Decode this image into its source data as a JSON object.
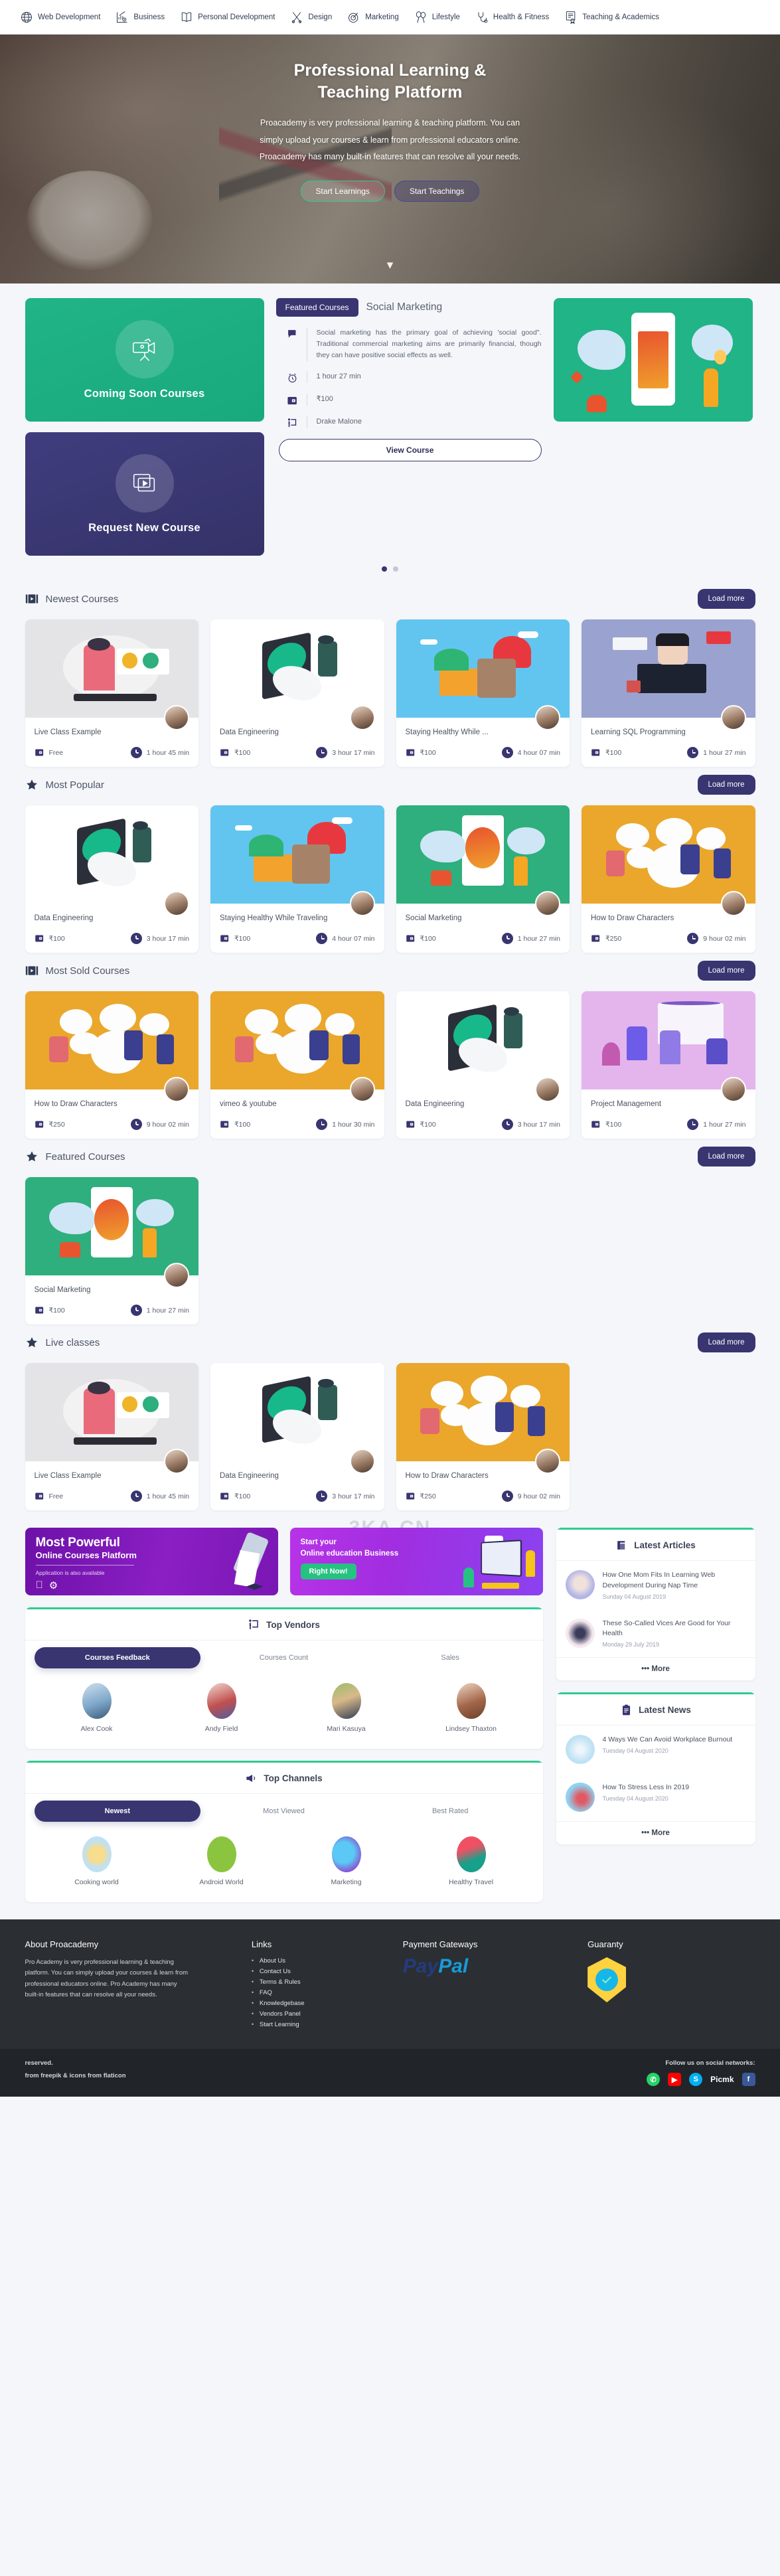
{
  "topbar": {
    "categories": [
      {
        "label": "Web Development",
        "icon": "globe-icon"
      },
      {
        "label": "Business",
        "icon": "chart-dollar-icon"
      },
      {
        "label": "Personal Development",
        "icon": "open-book-icon"
      },
      {
        "label": "Design",
        "icon": "scissors-icon"
      },
      {
        "label": "Marketing",
        "icon": "target-icon"
      },
      {
        "label": "Lifestyle",
        "icon": "balloons-icon"
      },
      {
        "label": "Health & Fitness",
        "icon": "stethoscope-icon"
      },
      {
        "label": "Teaching & Academics",
        "icon": "certificate-icon"
      }
    ]
  },
  "hero": {
    "title_line1": "Professional Learning &",
    "title_line2": "Teaching Platform",
    "paragraph": "Proacademy is very professional learning & teaching platform. You can simply upload your courses & learn from professional educators online. Proacademy has many built-in features that can resolve all your needs.",
    "btn_learn": "Start Learnings",
    "btn_teach": "Start Teachings",
    "scroll_icon": "chevron-down-icon"
  },
  "promo_cards": [
    {
      "title": "Coming Soon Courses",
      "icon": "video-camera-icon",
      "color": "#18a97c"
    },
    {
      "title": "Request New Course",
      "icon": "video-play-icon",
      "color": "#353268"
    }
  ],
  "featured_panel": {
    "tab_label": "Featured Courses",
    "course_name": "Social Marketing",
    "description": "Social marketing has the primary goal of achieving 'social good\". Traditional commercial marketing aims are primarily financial, though they can have positive social effects as well.",
    "duration": "1 hour 27 min",
    "price": "₹100",
    "author": "Drake Malone",
    "view_button": "View Course",
    "dots": [
      "active",
      "inactive"
    ]
  },
  "sections": [
    {
      "title": "Newest Courses",
      "icon": "film-strip-icon",
      "load_more": "Load more",
      "cards": [
        {
          "name": "Live Class Example",
          "price": "Free",
          "duration": "1 hour 45 min",
          "thumb": "t-live"
        },
        {
          "name": "Data Engineering",
          "price": "₹100",
          "duration": "3 hour 17 min",
          "thumb": "t-white"
        },
        {
          "name": "Staying Healthy While ...",
          "price": "₹100",
          "duration": "4 hour 07 min",
          "thumb": "t-blue"
        },
        {
          "name": "Learning SQL Programming",
          "price": "₹100",
          "duration": "1 hour 27 min",
          "thumb": "t-purpleblue"
        }
      ]
    },
    {
      "title": "Most Popular",
      "icon": "star-icon",
      "load_more": "Load more",
      "cards": [
        {
          "name": "Data Engineering",
          "price": "₹100",
          "duration": "3 hour 17 min",
          "thumb": "t-white"
        },
        {
          "name": "Staying Healthy While Traveling",
          "price": "₹100",
          "duration": "4 hour 07 min",
          "thumb": "t-blue"
        },
        {
          "name": "Social Marketing",
          "price": "₹100",
          "duration": "1 hour 27 min",
          "thumb": "t-green"
        },
        {
          "name": "How to Draw Characters",
          "price": "₹250",
          "duration": "9 hour 02 min",
          "thumb": "t-orange"
        }
      ]
    },
    {
      "title": "Most Sold Courses",
      "icon": "film-strip-icon",
      "load_more": "Load more",
      "cards": [
        {
          "name": "How to Draw Characters",
          "price": "₹250",
          "duration": "9 hour 02 min",
          "thumb": "t-orange"
        },
        {
          "name": "vimeo & youtube",
          "price": "₹100",
          "duration": "1 hour 30 min",
          "thumb": "t-orange"
        },
        {
          "name": "Data Engineering",
          "price": "₹100",
          "duration": "3 hour 17 min",
          "thumb": "t-white"
        },
        {
          "name": "Project Management",
          "price": "₹100",
          "duration": "1 hour 27 min",
          "thumb": "t-pink"
        }
      ]
    },
    {
      "title": "Featured Courses",
      "icon": "star-icon",
      "load_more": "Load more",
      "cards": [
        {
          "name": "Social Marketing",
          "price": "₹100",
          "duration": "1 hour 27 min",
          "thumb": "t-green"
        }
      ]
    },
    {
      "title": "Live classes",
      "icon": "star-icon",
      "load_more": "Load more",
      "cards": [
        {
          "name": "Live Class Example",
          "price": "Free",
          "duration": "1 hour 45 min",
          "thumb": "t-live"
        },
        {
          "name": "Data Engineering",
          "price": "₹100",
          "duration": "3 hour 17 min",
          "thumb": "t-white"
        },
        {
          "name": "How to Draw Characters",
          "price": "₹250",
          "duration": "9 hour 02 min",
          "thumb": "t-orange"
        }
      ]
    }
  ],
  "watermark": "3KA.CN",
  "banner1": {
    "title": "Most Powerful",
    "subtitle": "Online Courses Platform",
    "note": "Application is also available",
    "icons": [
      "apple-icon",
      "android-icon"
    ]
  },
  "banner2": {
    "line1": "Start your",
    "line2": "Online education Business",
    "button": "Right Now!"
  },
  "top_vendors": {
    "title": "Top Vendors",
    "icon": "presenter-icon",
    "tabs": [
      {
        "label": "Courses Feedback",
        "active": true
      },
      {
        "label": "Courses Count",
        "active": false
      },
      {
        "label": "Sales",
        "active": false
      }
    ],
    "people": [
      "Alex Cook",
      "Andy Field",
      "Mari Kasuya",
      "Lindsey Thaxton"
    ]
  },
  "top_channels": {
    "title": "Top Channels",
    "icon": "megaphone-icon",
    "tabs": [
      {
        "label": "Newest",
        "active": true
      },
      {
        "label": "Most Viewed",
        "active": false
      },
      {
        "label": "Best Rated",
        "active": false
      }
    ],
    "channels": [
      "Cooking world",
      "Android World",
      "Marketing",
      "Healthy Travel"
    ]
  },
  "latest_articles": {
    "title": "Latest Articles",
    "icon": "scroll-icon",
    "items": [
      {
        "title": "How One Mom Fits In Learning Web Development During Nap Time",
        "date": "Sunday 04 August 2019"
      },
      {
        "title": "These So-Called Vices Are Good for Your Health",
        "date": "Monday 29 July 2019"
      }
    ],
    "more": "••• More"
  },
  "latest_news": {
    "title": "Latest News",
    "icon": "clipboard-icon",
    "items": [
      {
        "title": "4 Ways We Can Avoid Workplace Burnout",
        "date": "Tuesday 04 August 2020"
      },
      {
        "title": "How To Stress Less In 2019",
        "date": "Tuesday 04 August 2020"
      }
    ],
    "more": "••• More"
  },
  "footer": {
    "about_title": "About Proacademy",
    "about_text": "Pro Academy is very professional learning & teaching platform. You can simply upload your courses & learn from professional educators online. Pro Academy has many built-in features that can resolve all your needs.",
    "links_title": "Links",
    "links": [
      "About Us",
      "Contact Us",
      "Terms & Rules",
      "FAQ",
      "Knowledgebase",
      "Vendors Panel",
      "Start Learning"
    ],
    "payment_title": "Payment Gateways",
    "paypal_a": "Pay",
    "paypal_b": "Pal",
    "guaranty_title": "Guaranty",
    "copyright": "reserved.",
    "credits": "from freepik & icons from flaticon",
    "social_label": "Follow us on social networks:",
    "socials": [
      "whatsapp-icon",
      "youtube-icon",
      "skype-icon",
      "facebook-icon"
    ],
    "picmk": "Picmk"
  }
}
